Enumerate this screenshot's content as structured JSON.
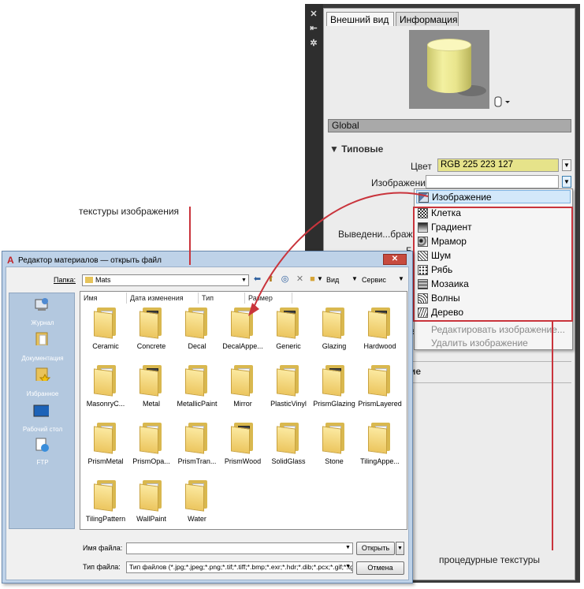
{
  "palette": {
    "tabs": [
      {
        "label": "Внешний вид"
      },
      {
        "label": "Информация"
      }
    ],
    "material_name": "Global",
    "section_typical": "Типовые",
    "color_label": "Цвет",
    "color_value": "RGB 225 223 127",
    "image_label": "Изображение",
    "hidden_label": "Выведени...браже",
    "partial_label": "Б",
    "fragment_1": "е",
    "fragment_2": "ие"
  },
  "texture_menu": {
    "items": [
      {
        "label": "Изображение",
        "icon": "image-texture-icon",
        "highlighted": true
      },
      {
        "label": "Клетка",
        "icon": "checker-texture-icon"
      },
      {
        "label": "Градиент",
        "icon": "gradient-texture-icon"
      },
      {
        "label": "Мрамор",
        "icon": "marble-texture-icon"
      },
      {
        "label": "Шум",
        "icon": "noise-texture-icon"
      },
      {
        "label": "Рябь",
        "icon": "speckle-texture-icon"
      },
      {
        "label": "Мозаика",
        "icon": "tiles-texture-icon"
      },
      {
        "label": "Волны",
        "icon": "waves-texture-icon"
      },
      {
        "label": "Дерево",
        "icon": "wood-texture-icon"
      }
    ],
    "edit_image": "Редактировать изображение...",
    "delete_image": "Удалить изображение"
  },
  "dialog": {
    "title": "Редактор материалов — открыть файл",
    "folder_label": "Папка:",
    "folder_value": "Mats",
    "view_label": "Вид",
    "service_label": "Сервис",
    "places": [
      "Журнал",
      "Документация",
      "Избранное",
      "Рабочий стол",
      "FTP"
    ],
    "columns": [
      "Имя",
      "Дата изменения",
      "Тип",
      "Размер"
    ],
    "files": [
      "Ceramic",
      "Concrete",
      "Decal",
      "DecalAppe...",
      "Generic",
      "Glazing",
      "Hardwood",
      "MasonryC...",
      "Metal",
      "MetallicPaint",
      "Mirror",
      "PlasticVinyl",
      "PrismGlazing",
      "PrismLayered",
      "PrismMetal",
      "PrismOpa...",
      "PrismTran...",
      "PrismWood",
      "SolidGlass",
      "Stone",
      "TilingAppe...",
      "TilingPattern",
      "WallPaint",
      "Water"
    ],
    "filename_label": "Имя файла:",
    "filetype_label": "Тип файла:",
    "filetype_value": "Тип файлов (*.jpg;*.jpeg;*.png;*.tif;*.tiff;*.bmp;*.exr;*.hdr;*.dib;*.pcx;*.gif;*.tga;",
    "open_button": "Открыть",
    "cancel_button": "Отмена"
  },
  "callouts": {
    "image_textures": "текстуры изображения",
    "procedural_textures": "процедурные текстуры"
  },
  "colors": {
    "accent_red": "#c9343c",
    "color_swatch": "#e6e38a"
  }
}
